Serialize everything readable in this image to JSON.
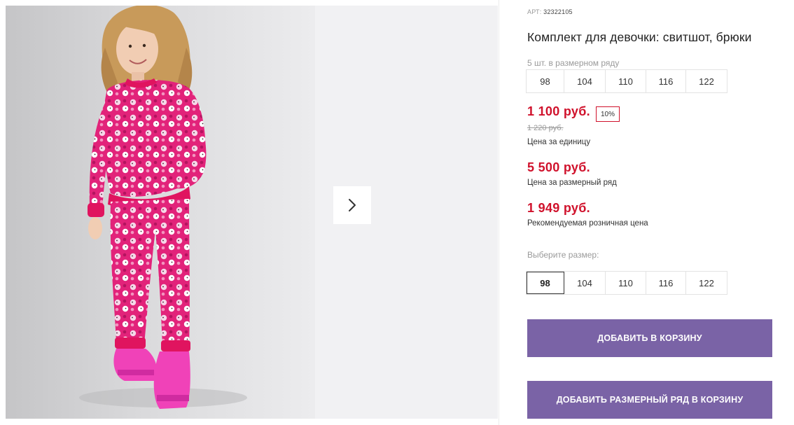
{
  "product": {
    "art_label": "АРТ:",
    "art_number": "32322105",
    "title": "Комплект для девочки: свитшот, брюки"
  },
  "size_pack": {
    "label": "5 шт. в размерном ряду",
    "sizes": [
      "98",
      "104",
      "110",
      "116",
      "122"
    ]
  },
  "pricing": {
    "unit_price": "1 100 руб.",
    "discount": "10%",
    "old_price": "1 220 руб.",
    "unit_caption": "Цена за единицу",
    "pack_price": "5 500 руб.",
    "pack_caption": "Цена за размерный ряд",
    "retail_price": "1 949 руб.",
    "retail_caption": "Рекомендуемая розничная цена",
    "price_color": "#d0122c"
  },
  "size_select": {
    "label": "Выберите размер:",
    "options": [
      "98",
      "104",
      "110",
      "116",
      "122"
    ],
    "selected": "98"
  },
  "actions": {
    "add_to_cart": "ДОБАВИТЬ В КОРЗИНУ",
    "add_pack_to_cart": "ДОБАВИТЬ РАЗМЕРНЫЙ РЯД В КОРЗИНУ",
    "button_color": "#7a63a6"
  },
  "gallery": {
    "next_icon": "chevron-right-icon",
    "outfit_color": "#e2237a"
  }
}
